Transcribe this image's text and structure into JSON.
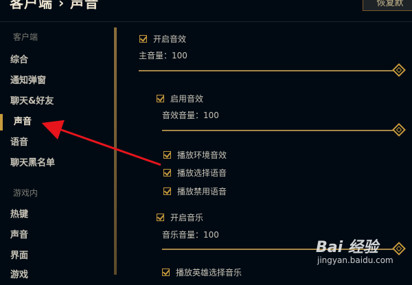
{
  "header": {
    "title": "客户端 › 声音",
    "restore_label": "恢复默"
  },
  "sidebar": {
    "client_section": "客户端",
    "client_items": [
      "综合",
      "通知弹窗",
      "聊天&好友",
      "声音",
      "语音",
      "聊天黑名单"
    ],
    "active_item": "声音",
    "game_section": "游戏内",
    "game_items": [
      "热键",
      "声音",
      "界面",
      "游戏"
    ]
  },
  "settings": {
    "master_enable": "开启音效",
    "master_volume": "主音量：100",
    "sfx_enable": "启用音效",
    "sfx_volume": "音效音量：100",
    "ambient": "播放环境音效",
    "pick_voice": "播放选择语音",
    "ban_voice": "播放禁用语音",
    "music_enable": "开启音乐",
    "music_volume": "音乐音量：100",
    "champ_music": "播放英雄选择音乐"
  },
  "levels": {
    "master": 1.0,
    "sfx": 1.0,
    "music": 1.0
  },
  "watermark": {
    "main": "Bai 经验",
    "sub": "jingyan.baidu.com"
  },
  "colors": {
    "background": "#010a13",
    "gold": "#c89b3c",
    "arrow": "#e8141c"
  }
}
